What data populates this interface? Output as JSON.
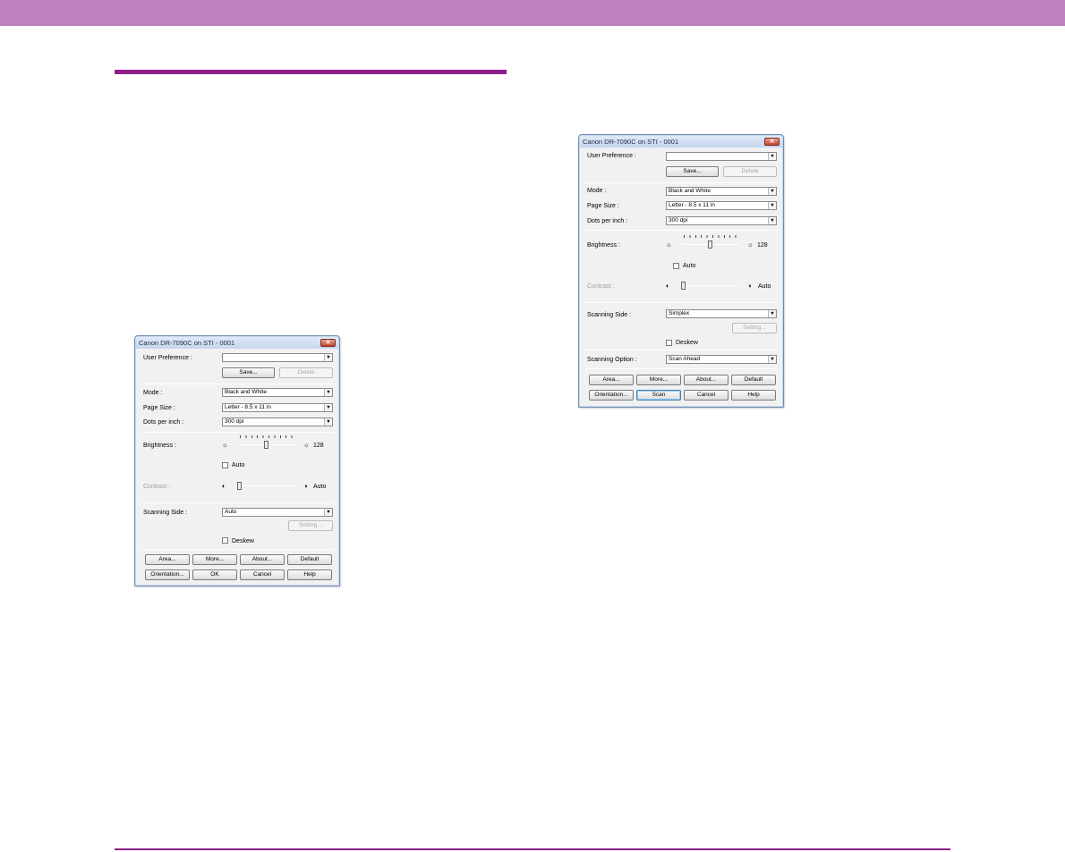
{
  "dialogs": [
    {
      "title": "Canon DR-7090C on STI - 0001",
      "close_glyph": "✕",
      "user_preference": {
        "label": "User Preference :",
        "value": ""
      },
      "save_label": "Save...",
      "delete_label": "Delete",
      "mode": {
        "label": "Mode :",
        "value": "Black and White"
      },
      "page_size": {
        "label": "Page Size :",
        "value": "Letter - 8.5 x 11 in"
      },
      "dpi": {
        "label": "Dots per inch :",
        "value": "300 dpi"
      },
      "brightness": {
        "label": "Brightness :",
        "value": "128",
        "level": 0.5
      },
      "auto_label": "Auto",
      "contrast": {
        "label": "Contrast :",
        "value_label": "Auto",
        "level": 0.0
      },
      "scanning_side": {
        "label": "Scanning Side :",
        "value": "Auto"
      },
      "setting_label": "Setting...",
      "deskew_label": "Deskew",
      "buttons_row1": [
        "Area...",
        "More...",
        "About...",
        "Default"
      ],
      "buttons_row2": [
        "Orientation...",
        "OK",
        "Cancel",
        "Help"
      ]
    },
    {
      "title": "Canon DR-7090C on STI - 0001",
      "close_glyph": "✕",
      "user_preference": {
        "label": "User Preference :",
        "value": ""
      },
      "save_label": "Save...",
      "delete_label": "Delete",
      "mode": {
        "label": "Mode :",
        "value": "Black and White"
      },
      "page_size": {
        "label": "Page Size :",
        "value": "Letter - 8.5 x 11 in"
      },
      "dpi": {
        "label": "Dots per inch :",
        "value": "300 dpi"
      },
      "brightness": {
        "label": "Brightness :",
        "value": "128",
        "level": 0.5
      },
      "auto_label": "Auto",
      "contrast": {
        "label": "Contrast :",
        "value_label": "Auto",
        "level": 0.0
      },
      "scanning_side": {
        "label": "Scanning Side :",
        "value": "Simplex"
      },
      "setting_label": "Setting...",
      "deskew_label": "Deskew",
      "scanning_option": {
        "label": "Scanning Option :",
        "value": "Scan Ahead"
      },
      "buttons_row1": [
        "Area...",
        "More...",
        "About...",
        "Default"
      ],
      "buttons_row2": [
        "Orientation...",
        "Scan",
        "Cancel",
        "Help"
      ]
    }
  ],
  "icons": {
    "brightness": "sun-icon",
    "contrast": "half-circle-icon",
    "dropdown": "chevron-down-icon"
  },
  "colors": {
    "band": "#bf81bf",
    "rule": "#8d1e8a"
  }
}
